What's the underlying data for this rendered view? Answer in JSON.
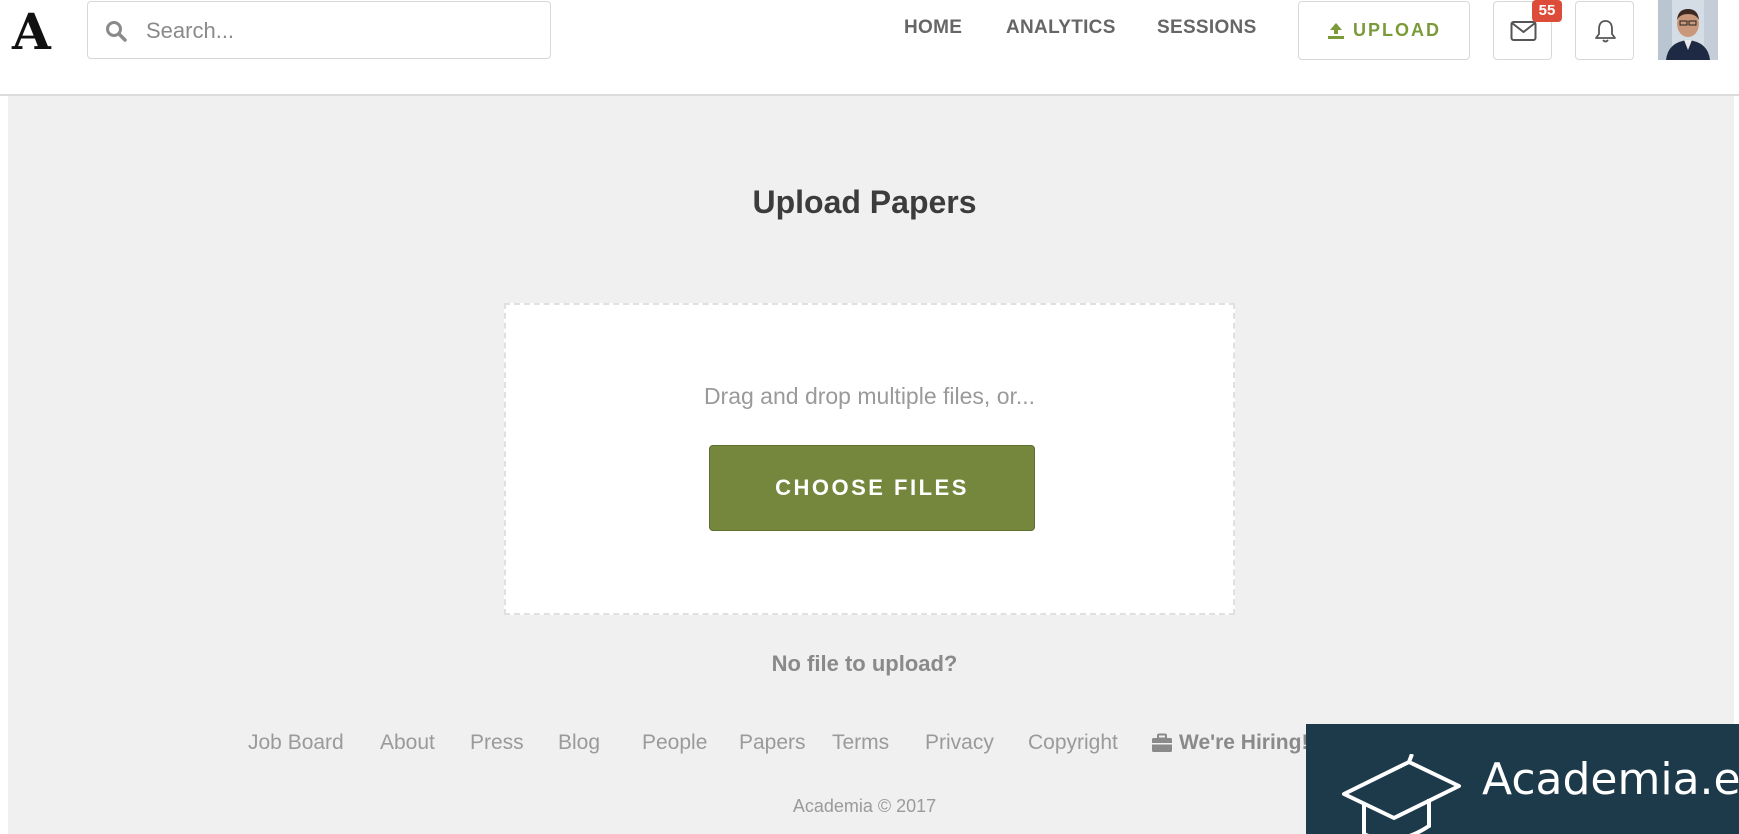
{
  "header": {
    "logo": "A",
    "search": {
      "placeholder": "Search...",
      "value": ""
    },
    "nav": [
      {
        "label": "HOME"
      },
      {
        "label": "ANALYTICS"
      },
      {
        "label": "SESSIONS"
      }
    ],
    "upload_label": "UPLOAD",
    "messages_badge": "55",
    "accent_color": "#7b9a3a",
    "badge_color": "#dd4b39"
  },
  "main": {
    "title": "Upload Papers",
    "dropzone": {
      "hint": "Drag and drop multiple files, or...",
      "button_label": "CHOOSE FILES",
      "button_color": "#75873d"
    },
    "no_file": "No file to upload?"
  },
  "footer": {
    "links": [
      {
        "label": "Job Board"
      },
      {
        "label": "About"
      },
      {
        "label": "Press"
      },
      {
        "label": "Blog"
      },
      {
        "label": "People"
      },
      {
        "label": "Papers"
      },
      {
        "label": "Terms"
      },
      {
        "label": "Privacy"
      },
      {
        "label": "Copyright"
      }
    ],
    "hiring_label": "We're Hiring!",
    "copyright": "Academia © 2017"
  },
  "banner": {
    "text": "Academia.e",
    "background_color": "#1d3a4a"
  },
  "icons": {
    "search": "search-icon",
    "upload": "upload-icon",
    "messages": "envelope-icon",
    "notifications": "bell-icon",
    "hiring": "briefcase-icon",
    "banner": "graduation-cap-icon"
  }
}
